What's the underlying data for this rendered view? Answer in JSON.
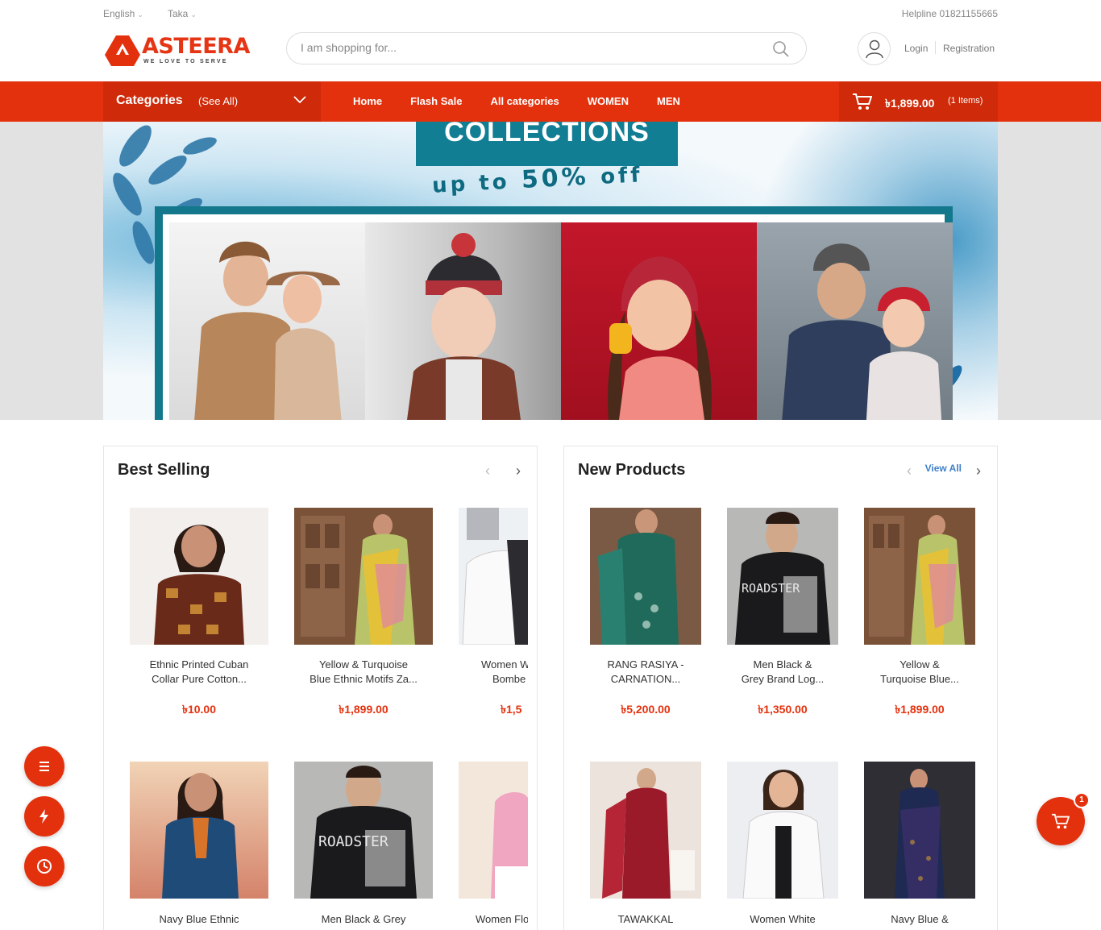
{
  "topbar": {
    "language": "English",
    "currency": "Taka",
    "helpline": "Helpline 01821155665"
  },
  "brand": {
    "name": "ASTEERA",
    "tagline": "WE LOVE TO SERVE",
    "color": "#e4310d"
  },
  "search": {
    "placeholder": "I am shopping for..."
  },
  "account": {
    "login": "Login",
    "registration": "Registration"
  },
  "nav": {
    "categories_label": "Categories",
    "see_all": "(See All)",
    "links": [
      "Home",
      "Flash Sale",
      "All categories",
      "WOMEN",
      "MEN"
    ],
    "cart_amount": "৳1,899.00",
    "cart_items": "(1 Items)"
  },
  "banner": {
    "title": "COLLECTIONS",
    "offer_prefix": "up to",
    "offer_value": "50%",
    "offer_suffix": "off"
  },
  "best_selling": {
    "title": "Best Selling",
    "products": [
      {
        "name_line1": "Ethnic Printed Cuban",
        "name_line2": "Collar Pure Cotton...",
        "price": "৳10.00"
      },
      {
        "name_line1": "Yellow & Turquoise",
        "name_line2": "Blue Ethnic Motifs Za...",
        "price": "৳1,899.00"
      },
      {
        "name_line1": "Women W",
        "name_line2": "Bombe",
        "price": "৳1,5"
      },
      {
        "name_line1": "Navy Blue Ethnic",
        "name_line2": "",
        "price": ""
      },
      {
        "name_line1": "Men Black & Grey",
        "name_line2": "",
        "price": ""
      },
      {
        "name_line1": "Women Flo",
        "name_line2": "",
        "price": ""
      }
    ]
  },
  "new_products": {
    "title": "New Products",
    "view_all": "View All",
    "products": [
      {
        "name_line1": "RANG RASIYA -",
        "name_line2": "CARNATION...",
        "price": "৳5,200.00"
      },
      {
        "name_line1": "Men Black &",
        "name_line2": "Grey Brand Log...",
        "price": "৳1,350.00"
      },
      {
        "name_line1": "Yellow &",
        "name_line2": "Turquoise Blue...",
        "price": "৳1,899.00"
      },
      {
        "name_line1": "TAWAKKAL",
        "name_line2": "",
        "price": ""
      },
      {
        "name_line1": "Women White",
        "name_line2": "",
        "price": ""
      },
      {
        "name_line1": "Navy Blue &",
        "name_line2": "",
        "price": ""
      }
    ]
  },
  "floating_cart": {
    "count": "1"
  }
}
